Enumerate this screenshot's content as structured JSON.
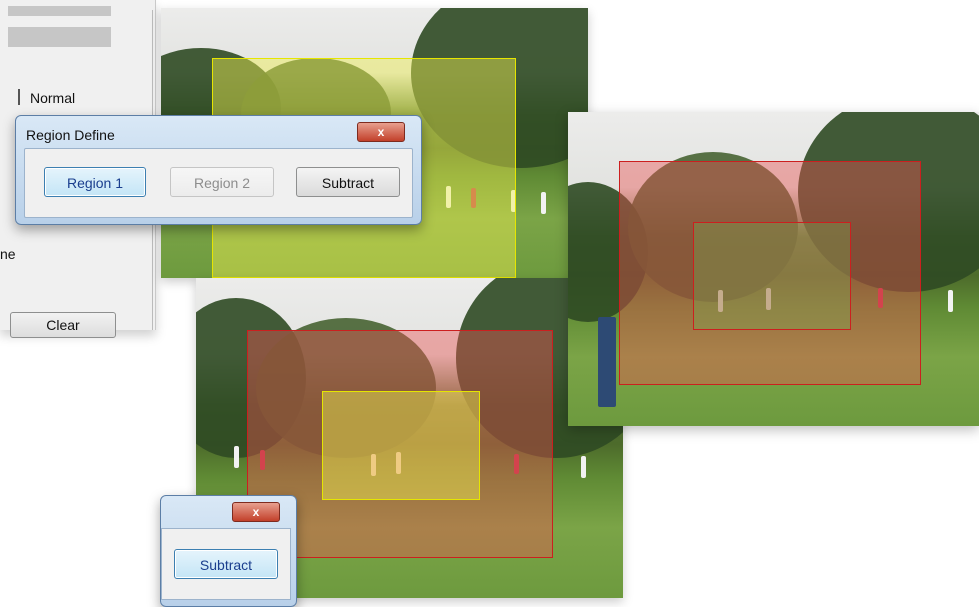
{
  "panel": {
    "mode_label": "Normal",
    "cut_label": "ne",
    "clear_label": "Clear"
  },
  "dialog": {
    "title": "Region Define",
    "close_glyph": "x",
    "buttons": [
      {
        "label": "Region 1",
        "state": "focused"
      },
      {
        "label": "Region 2",
        "state": "disabled"
      },
      {
        "label": "Subtract",
        "state": "normal"
      }
    ]
  },
  "dialog_small": {
    "close_glyph": "x",
    "subtract_label": "Subtract"
  },
  "colors": {
    "region_yellow": "#e6e600",
    "region_red": "#cc1f1f",
    "dialog_frame": "#b8d0e9"
  }
}
